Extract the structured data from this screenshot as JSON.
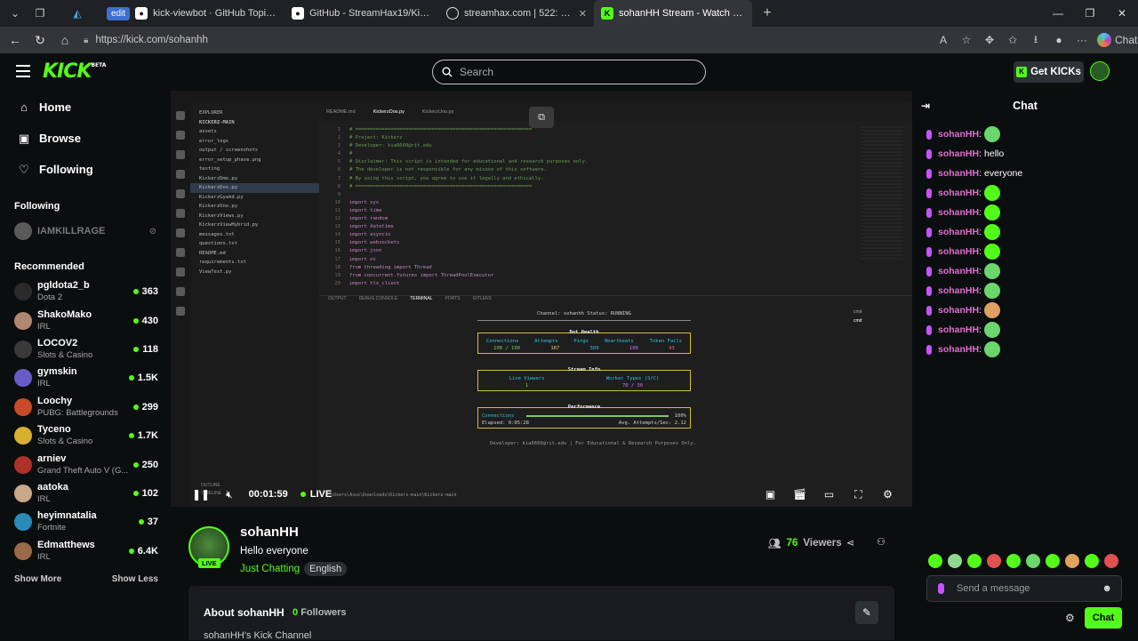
{
  "browser": {
    "tabs": [
      {
        "label": "kick-viewbot · GitHub Topics · GitH",
        "icon": "github-icon"
      },
      {
        "label": "GitHub - StreamHax19/Kick-Views",
        "icon": "github-icon"
      },
      {
        "label": "streamhax.com | 522: Connection t",
        "icon": "globe-icon"
      },
      {
        "label": "sohanHH Stream - Watch Live on K",
        "icon": "kick-icon",
        "active": true
      }
    ],
    "edit_badge": "edit",
    "url": "https://kick.com/sohanhh",
    "copilot_label": "Chat"
  },
  "header": {
    "logo": "KICK",
    "logo_beta": "BETA",
    "search_placeholder": "Search",
    "get_kicks": "Get KICKs"
  },
  "sidebar": {
    "nav": [
      {
        "label": "Home",
        "icon": "home-icon"
      },
      {
        "label": "Browse",
        "icon": "browse-icon"
      },
      {
        "label": "Following",
        "icon": "heart-icon"
      }
    ],
    "following_title": "Following",
    "following": [
      {
        "name": "IAMKILLRAGE"
      }
    ],
    "recommended_title": "Recommended",
    "recommended": [
      {
        "name": "pgldota2_b",
        "category": "Dota 2",
        "viewers": "363",
        "color": "#2a2a2a"
      },
      {
        "name": "ShakoMako",
        "category": "IRL",
        "viewers": "430",
        "color": "#b08870"
      },
      {
        "name": "LOCOV2",
        "category": "Slots & Casino",
        "viewers": "118",
        "color": "#3a3a3a"
      },
      {
        "name": "gymskin",
        "category": "IRL",
        "viewers": "1.5K",
        "color": "#6a5ac8"
      },
      {
        "name": "Loochy",
        "category": "PUBG: Battlegrounds",
        "viewers": "299",
        "color": "#c84a2a"
      },
      {
        "name": "Tyceno",
        "category": "Slots & Casino",
        "viewers": "1.7K",
        "color": "#d8b030"
      },
      {
        "name": "arniev",
        "category": "Grand Theft Auto V (G...",
        "viewers": "250",
        "color": "#b0302a"
      },
      {
        "name": "aatoka",
        "category": "IRL",
        "viewers": "102",
        "color": "#c8a888"
      },
      {
        "name": "heyimnatalia",
        "category": "Fortnite",
        "viewers": "37",
        "color": "#2a8ab8"
      },
      {
        "name": "Edmatthews",
        "category": "IRL",
        "viewers": "6.4K",
        "color": "#9a6a4a"
      }
    ],
    "show_more": "Show More",
    "show_less": "Show Less"
  },
  "player": {
    "time": "00:01:59",
    "live": "LIVE",
    "screen": {
      "explorer_title": "EXPLORER",
      "project": "KICKERZ-MAIN",
      "files": [
        "assets",
        "error_logs",
        "output / screenshots",
        "error_setup_phase.png",
        "testing",
        "KickerzDmo.py",
        "KickerzDos.py",
        "KickerzGyakd.py",
        "KickerzUno.py",
        "KickerzViews.py",
        "KickerzViewHybrid.py",
        "messages.txt",
        "questions.txt",
        "README.md",
        "requirements.txt",
        "ViewText.py"
      ],
      "editor_tabs": [
        "README.md",
        "KickerzDos.py",
        "KickerzUno.py"
      ],
      "code": [
        "# ============================================================",
        "# Project: Kickerz",
        "# Developer: kia6660@rit.edu",
        "#",
        "# Disclaimer: This script is intended for educational and research purposes only.",
        "# The developer is not responsible for any misuse of this software.",
        "# By using this script, you agree to use it legally and ethically.",
        "# ============================================================",
        "",
        "import sys",
        "import time",
        "import random",
        "import datetime",
        "import asyncio",
        "import websockets",
        "import json",
        "import os",
        "from threading import Thread",
        "from concurrent.futures import ThreadPoolExecutor",
        "import tls_client"
      ],
      "terminal_tabs": [
        "OUTPUT",
        "DEBUG CONSOLE",
        "TERMINAL",
        "PORTS",
        "GITLENS"
      ],
      "channel_line": "Channel: sohanhh   Status: RUNNING",
      "bot_health_title": "Bot Health",
      "bot_health_labels": [
        "Connections",
        "Attempts",
        "Pings",
        "Heartbeats",
        "Token Fails"
      ],
      "bot_health_values": [
        "100 / 100",
        "187",
        "509",
        "100",
        "43"
      ],
      "stream_info_title": "Stream Info",
      "stream_info_labels": [
        "Live Viewers",
        "Worker Types (S/C)"
      ],
      "stream_info_values": [
        "1",
        "70 / 30"
      ],
      "performance_title": "Performance",
      "perf_connections": "Connections",
      "perf_percent": "100%",
      "perf_elapsed": "Elapsed: 0:05:28",
      "perf_avg": "Avg. Attempts/Sec: 2.12",
      "footer": "Developer: kia6660@rit.edu | For Educational & Research Purposes Only.",
      "cmd_items": [
        "cmd",
        "cmd"
      ],
      "outline": "OUTLINE",
      "timeline": "TIMELINE",
      "path": "\\Users\\Asus\\Downloads\\Kickerz-main\\Kickerz-main"
    }
  },
  "streamer": {
    "name": "sohanHH",
    "live_badge": "LIVE",
    "title": "Hello everyone",
    "category": "Just Chatting",
    "tag": "English",
    "viewers_count": "76",
    "viewers_label": "Viewers"
  },
  "about": {
    "title": "About sohanHH",
    "followers_count": "0",
    "followers_label": "Followers",
    "description": "sohanHH's Kick Channel"
  },
  "chat": {
    "title": "Chat",
    "messages": [
      {
        "user": "sohanHH",
        "text": "",
        "emote": "#6bd66b"
      },
      {
        "user": "sohanHH",
        "text": "hello",
        "emote": ""
      },
      {
        "user": "sohanHH",
        "text": "everyone",
        "emote": ""
      },
      {
        "user": "sohanHH",
        "text": "",
        "emote": "#53fc18"
      },
      {
        "user": "sohanHH",
        "text": "",
        "emote": "#53fc18"
      },
      {
        "user": "sohanHH",
        "text": "",
        "emote": "#53fc18"
      },
      {
        "user": "sohanHH",
        "text": "",
        "emote": "#53fc18"
      },
      {
        "user": "sohanHH",
        "text": "",
        "emote": "#6bd66b"
      },
      {
        "user": "sohanHH",
        "text": "",
        "emote": "#6bd66b"
      },
      {
        "user": "sohanHH",
        "text": "",
        "emote": "#e0a060"
      },
      {
        "user": "sohanHH",
        "text": "",
        "emote": "#6bd66b"
      },
      {
        "user": "sohanHH",
        "text": "",
        "emote": "#6bd66b"
      }
    ],
    "emote_bar": [
      "#53fc18",
      "#8fd88f",
      "#53fc18",
      "#e05050",
      "#53fc18",
      "#6bd66b",
      "#53fc18",
      "#e0a060",
      "#53fc18",
      "#e05050"
    ],
    "input_placeholder": "Send a message",
    "send_label": "Chat"
  }
}
